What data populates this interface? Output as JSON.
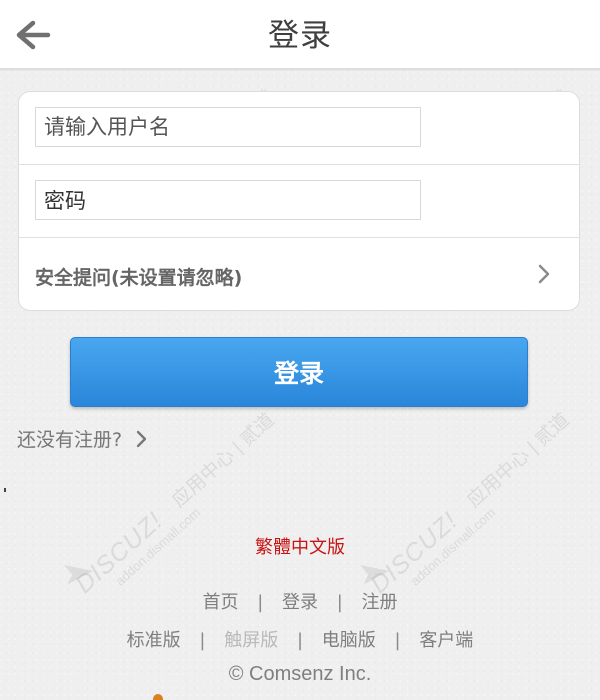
{
  "header": {
    "title": "登录",
    "back_icon": "back-arrow-icon"
  },
  "form": {
    "username_placeholder": "请输入用户名",
    "password_value": "密码",
    "security_question_label": "安全提问(未设置请忽略)",
    "security_question_icon": "chevron-right-icon"
  },
  "actions": {
    "login_label": "登录",
    "register_label": "还没有注册?",
    "register_icon": "chevron-right-icon"
  },
  "links": {
    "traditional_chinese": "繁體中文版"
  },
  "footer": {
    "main_links": [
      "首页",
      "登录",
      "注册"
    ],
    "version_links": [
      "标准版",
      "触屏版",
      "电脑版",
      "客户端"
    ],
    "copyright": "© Comsenz Inc."
  },
  "watermark": {
    "brand": "DISCUZ!",
    "url": "addon.dismall.com",
    "label": "应用中心 | 贰道"
  },
  "colors": {
    "primary_button": "#2a86da",
    "traditional_link": "#c81414",
    "page_background": "#efefef"
  }
}
